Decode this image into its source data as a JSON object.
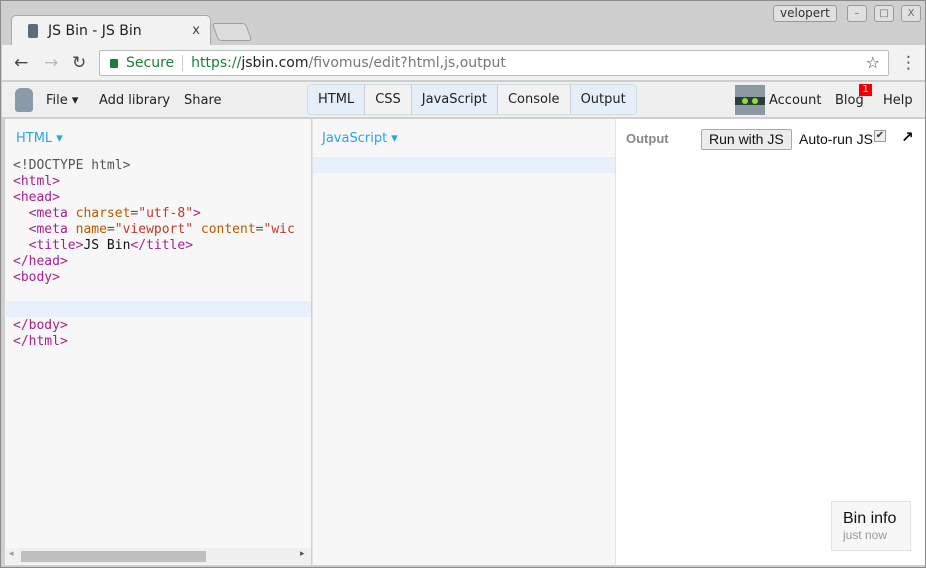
{
  "browser": {
    "tab_title": "JS Bin - JS Bin",
    "tab_close": "x",
    "user": "velopert",
    "min": "–",
    "max": "□",
    "close": "X",
    "secure": "Secure",
    "url_scheme": "https://",
    "url_host": "jsbin.com",
    "url_path": "/fivomus/edit?html,js,output",
    "back": "←",
    "forward": "→",
    "reload": "↻",
    "star": "☆",
    "menu": "⋮"
  },
  "toolbar": {
    "file": "File ▾",
    "add_library": "Add library",
    "share": "Share",
    "panels": [
      {
        "label": "HTML",
        "active": true
      },
      {
        "label": "CSS",
        "active": false
      },
      {
        "label": "JavaScript",
        "active": true
      },
      {
        "label": "Console",
        "active": false
      },
      {
        "label": "Output",
        "active": true
      }
    ],
    "account": "Account",
    "blog": "Blog",
    "blog_badge": "1",
    "help": "Help"
  },
  "html_panel": {
    "label": "HTML ▾",
    "lines": [
      [
        [
          "doc",
          "<!DOCTYPE html>"
        ]
      ],
      [
        [
          "tag",
          "<html>"
        ]
      ],
      [
        [
          "tag",
          "<head>"
        ]
      ],
      [
        [
          "txt",
          "  "
        ],
        [
          "tag",
          "<meta "
        ],
        [
          "attr",
          "charset"
        ],
        [
          "doc",
          "="
        ],
        [
          "str",
          "\"utf-8\""
        ],
        [
          "tag",
          ">"
        ]
      ],
      [
        [
          "txt",
          "  "
        ],
        [
          "tag",
          "<meta "
        ],
        [
          "attr",
          "name"
        ],
        [
          "doc",
          "="
        ],
        [
          "str",
          "\"viewport\""
        ],
        [
          "txt",
          " "
        ],
        [
          "attr",
          "content"
        ],
        [
          "doc",
          "="
        ],
        [
          "str",
          "\"wic"
        ]
      ],
      [
        [
          "txt",
          "  "
        ],
        [
          "tag",
          "<title>"
        ],
        [
          "txt",
          "JS Bin"
        ],
        [
          "tag",
          "</title>"
        ]
      ],
      [
        [
          "tag",
          "</head>"
        ]
      ],
      [
        [
          "tag",
          "<body>"
        ]
      ],
      [
        [
          "txt",
          ""
        ]
      ],
      [
        [
          "txt",
          ""
        ]
      ],
      [
        [
          "tag",
          "</body>"
        ]
      ],
      [
        [
          "tag",
          "</html>"
        ]
      ]
    ]
  },
  "js_panel": {
    "label": "JavaScript ▾"
  },
  "output_panel": {
    "label": "Output",
    "run_button": "Run with JS",
    "autorun": "Auto-run JS",
    "autorun_checked": true,
    "popout": "↗"
  },
  "bin_info": {
    "title": "Bin info",
    "subtitle": "just now"
  }
}
